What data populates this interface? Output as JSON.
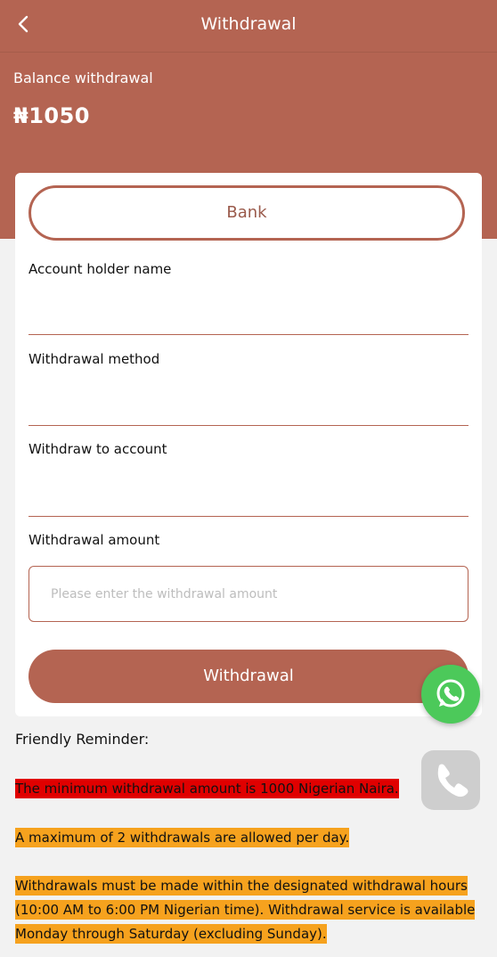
{
  "header": {
    "title": "Withdrawal",
    "back_icon": "chevron-left-icon"
  },
  "balance": {
    "label": "Balance withdrawal",
    "amount": "₦1050"
  },
  "form": {
    "method_button": "Bank",
    "fields": {
      "holder_name_label": "Account holder name",
      "method_label": "Withdrawal method",
      "account_label": "Withdraw to account",
      "amount_label": "Withdrawal amount",
      "amount_placeholder": "Please enter the withdrawal amount",
      "amount_value": ""
    },
    "submit_label": "Withdrawal"
  },
  "reminder": {
    "title": "Friendly Reminder:",
    "notes": [
      "The minimum withdrawal amount is 1000 Nigerian Naira.",
      "A maximum of 2 withdrawals are allowed per day.",
      "Withdrawals must be made within the designated withdrawal hours (10:00 AM to 6:00 PM Nigerian time). Withdrawal service is available Monday through Saturday (excluding Sunday)."
    ]
  },
  "floating": {
    "whatsapp_icon": "whatsapp-icon",
    "phone_icon": "phone-icon"
  },
  "colors": {
    "brand": "#b46452",
    "whatsapp": "#4cc95a",
    "notice_red": "#e00000",
    "notice_orange": "#f6a21e"
  }
}
